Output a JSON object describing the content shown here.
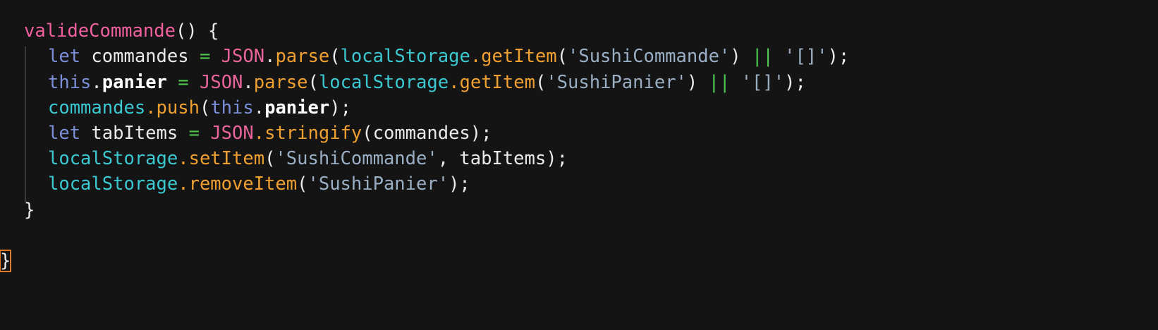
{
  "editor": {
    "lines": [
      [
        {
          "t": "valideCommande",
          "c": "fn"
        },
        {
          "t": "() {",
          "c": "pun"
        }
      ],
      [
        {
          "t": "let",
          "c": "kw"
        },
        {
          "t": " commandes ",
          "c": "var"
        },
        {
          "t": "=",
          "c": "op"
        },
        {
          "t": " ",
          "c": "pun"
        },
        {
          "t": "JSON",
          "c": "obj"
        },
        {
          "t": ".",
          "c": "pun"
        },
        {
          "t": "parse",
          "c": "meth"
        },
        {
          "t": "(",
          "c": "pun"
        },
        {
          "t": "localStorage",
          "c": "cyan"
        },
        {
          "t": ".",
          "c": "meth"
        },
        {
          "t": "getItem",
          "c": "meth"
        },
        {
          "t": "(",
          "c": "pun"
        },
        {
          "t": "'SushiCommande'",
          "c": "str"
        },
        {
          "t": ") ",
          "c": "pun"
        },
        {
          "t": "||",
          "c": "op"
        },
        {
          "t": " ",
          "c": "pun"
        },
        {
          "t": "'[]'",
          "c": "str"
        },
        {
          "t": ");",
          "c": "pun"
        }
      ],
      [
        {
          "t": "this",
          "c": "kw"
        },
        {
          "t": ".",
          "c": "pun"
        },
        {
          "t": "panier",
          "c": "prop"
        },
        {
          "t": " ",
          "c": "pun"
        },
        {
          "t": "=",
          "c": "op"
        },
        {
          "t": " ",
          "c": "pun"
        },
        {
          "t": "JSON",
          "c": "obj"
        },
        {
          "t": ".",
          "c": "pun"
        },
        {
          "t": "parse",
          "c": "meth"
        },
        {
          "t": "(",
          "c": "pun"
        },
        {
          "t": "localStorage",
          "c": "cyan"
        },
        {
          "t": ".",
          "c": "meth"
        },
        {
          "t": "getItem",
          "c": "meth"
        },
        {
          "t": "(",
          "c": "pun"
        },
        {
          "t": "'SushiPanier'",
          "c": "str"
        },
        {
          "t": ") ",
          "c": "pun"
        },
        {
          "t": "||",
          "c": "op"
        },
        {
          "t": " ",
          "c": "pun"
        },
        {
          "t": "'[]'",
          "c": "str"
        },
        {
          "t": ");",
          "c": "pun"
        }
      ],
      [
        {
          "t": "commandes",
          "c": "cyan"
        },
        {
          "t": ".",
          "c": "meth"
        },
        {
          "t": "push",
          "c": "meth"
        },
        {
          "t": "(",
          "c": "pun"
        },
        {
          "t": "this",
          "c": "kw"
        },
        {
          "t": ".",
          "c": "pun"
        },
        {
          "t": "panier",
          "c": "prop"
        },
        {
          "t": ");",
          "c": "pun"
        }
      ],
      [
        {
          "t": "let",
          "c": "kw"
        },
        {
          "t": " tabItems ",
          "c": "var"
        },
        {
          "t": "=",
          "c": "op"
        },
        {
          "t": " ",
          "c": "pun"
        },
        {
          "t": "JSON",
          "c": "obj"
        },
        {
          "t": ".",
          "c": "meth"
        },
        {
          "t": "stringify",
          "c": "meth"
        },
        {
          "t": "(commandes);",
          "c": "pun"
        }
      ],
      [
        {
          "t": "localStorage",
          "c": "cyan"
        },
        {
          "t": ".",
          "c": "meth"
        },
        {
          "t": "setItem",
          "c": "meth"
        },
        {
          "t": "(",
          "c": "pun"
        },
        {
          "t": "'SushiCommande'",
          "c": "str"
        },
        {
          "t": ", tabItems);",
          "c": "pun"
        }
      ],
      [
        {
          "t": "localStorage",
          "c": "cyan"
        },
        {
          "t": ".",
          "c": "meth"
        },
        {
          "t": "removeItem",
          "c": "meth"
        },
        {
          "t": "(",
          "c": "pun"
        },
        {
          "t": "'SushiPanier'",
          "c": "str"
        },
        {
          "t": ");",
          "c": "pun"
        }
      ],
      [
        {
          "t": "}",
          "c": "pun"
        }
      ],
      [],
      [
        {
          "t": "}",
          "c": "pun"
        }
      ]
    ]
  },
  "colors": {
    "background": "#141414",
    "function_name": "#f0609e",
    "keyword": "#7b8fd8",
    "operator": "#4fc94f",
    "method": "#f0a030",
    "identifier_cyan": "#3cc8d0",
    "string": "#9aaec4",
    "bracket_highlight": "#e07a28"
  }
}
